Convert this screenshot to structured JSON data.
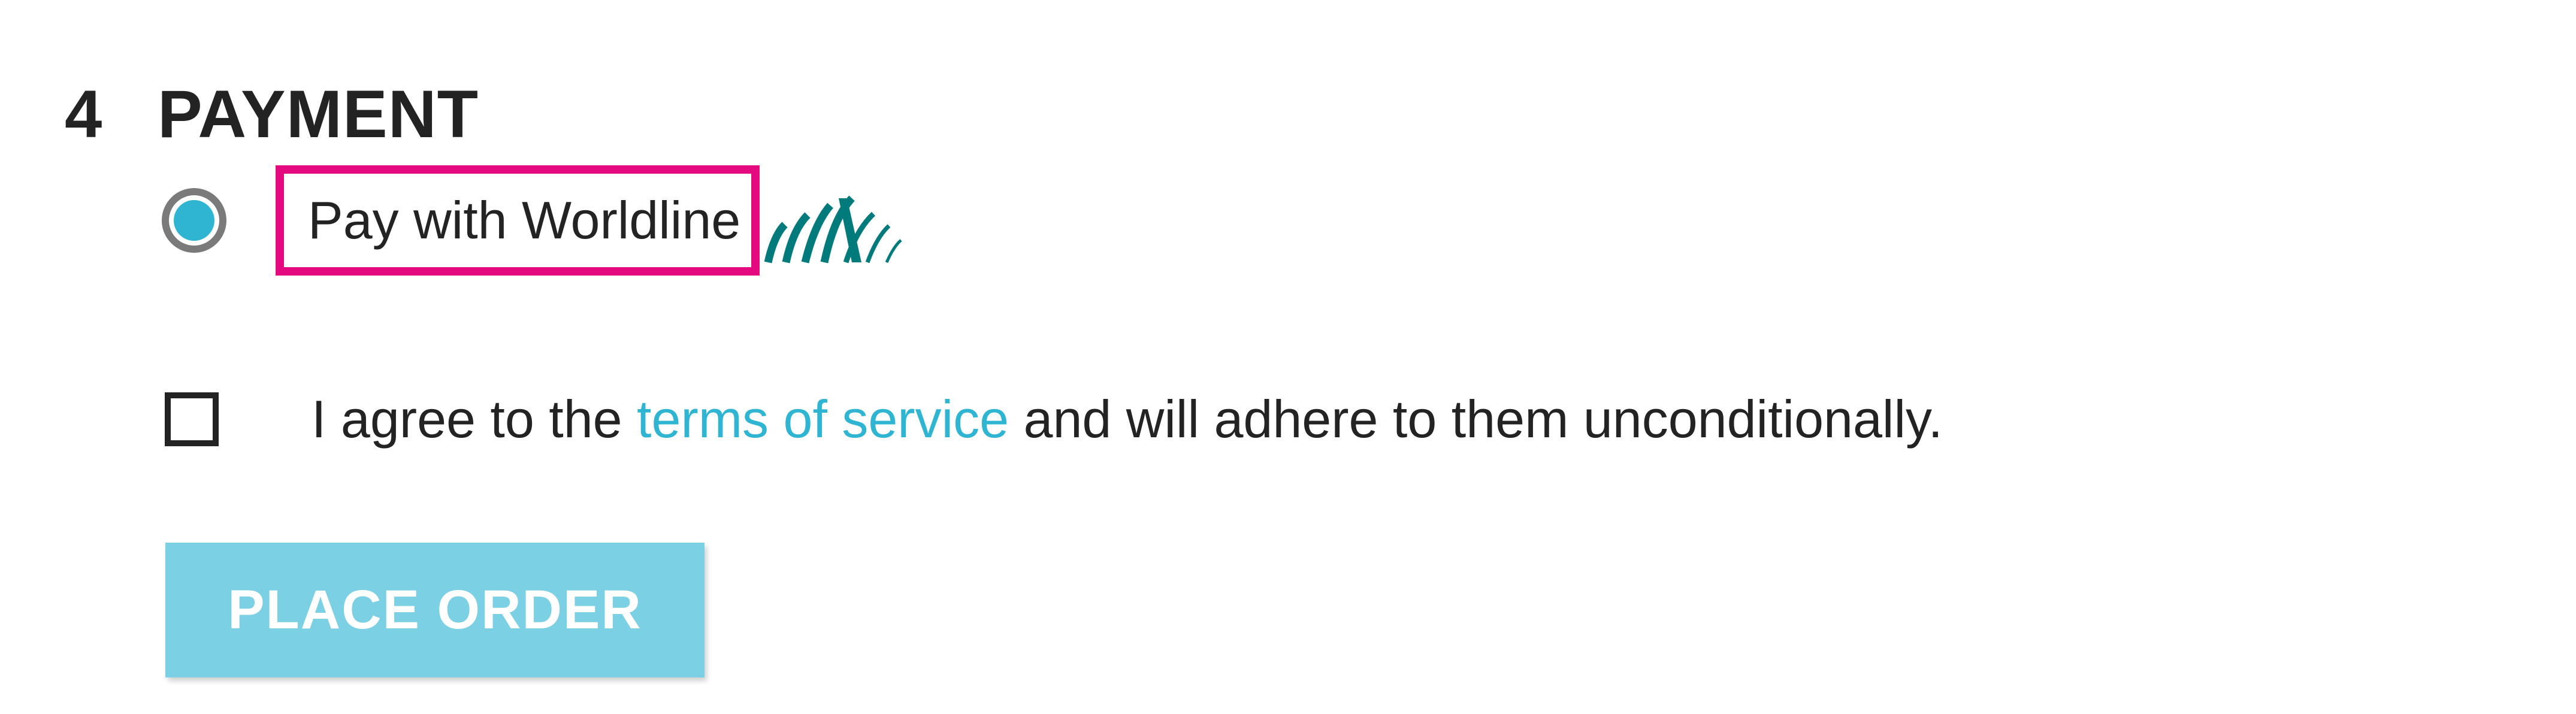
{
  "step": {
    "number": "4",
    "title": "PAYMENT"
  },
  "payment_option": {
    "label": "Pay with Worldline",
    "selected": true,
    "logo_icon": "worldline-logo-icon"
  },
  "terms": {
    "checked": false,
    "text_before": "I agree to the ",
    "link_text": "terms of service",
    "text_after": " and will adhere to them unconditionally."
  },
  "place_order": {
    "label": "PLACE ORDER",
    "enabled": false
  },
  "colors": {
    "accent": "#2fb5d2",
    "highlight_box": "#e5097f",
    "button_disabled": "#7bd1e3",
    "logo": "#007a7a",
    "text": "#232323"
  }
}
